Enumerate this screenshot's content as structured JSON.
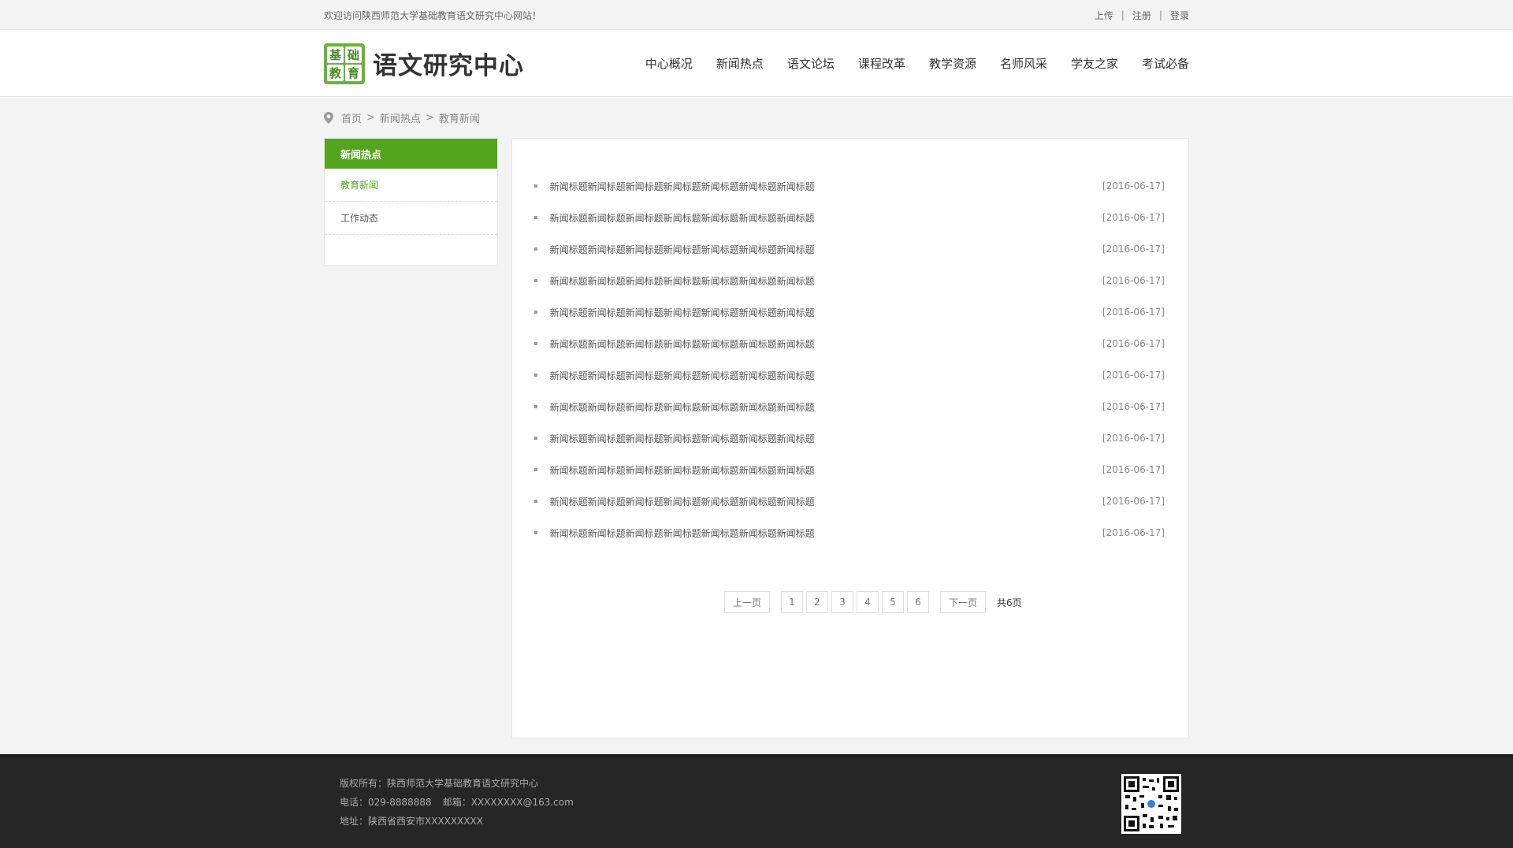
{
  "topbar": {
    "welcome": "欢迎访问陕西师范大学基础教育语文研究中心网站！",
    "links": [
      "上传",
      "注册",
      "登录"
    ]
  },
  "logo": {
    "badge_chars": [
      "基",
      "础",
      "教",
      "育"
    ],
    "title": "语文研究中心"
  },
  "nav": [
    "中心概况",
    "新闻热点",
    "语文论坛",
    "课程改革",
    "教学资源",
    "名师风采",
    "学友之家",
    "考试必备"
  ],
  "breadcrumb": {
    "items": [
      "首页",
      "新闻热点",
      "教育新闻"
    ],
    "separator": ">"
  },
  "sidebar": {
    "title": "新闻热点",
    "items": [
      {
        "label": "教育新闻",
        "active": true
      },
      {
        "label": "工作动态",
        "active": false
      }
    ]
  },
  "news": [
    {
      "title": "新闻标题新闻标题新闻标题新闻标题新闻标题新闻标题新闻标题",
      "date": "[2016-06-17]"
    },
    {
      "title": "新闻标题新闻标题新闻标题新闻标题新闻标题新闻标题新闻标题",
      "date": "[2016-06-17]"
    },
    {
      "title": "新闻标题新闻标题新闻标题新闻标题新闻标题新闻标题新闻标题",
      "date": "[2016-06-17]"
    },
    {
      "title": "新闻标题新闻标题新闻标题新闻标题新闻标题新闻标题新闻标题",
      "date": "[2016-06-17]"
    },
    {
      "title": "新闻标题新闻标题新闻标题新闻标题新闻标题新闻标题新闻标题",
      "date": "[2016-06-17]"
    },
    {
      "title": "新闻标题新闻标题新闻标题新闻标题新闻标题新闻标题新闻标题",
      "date": "[2016-06-17]"
    },
    {
      "title": "新闻标题新闻标题新闻标题新闻标题新闻标题新闻标题新闻标题",
      "date": "[2016-06-17]"
    },
    {
      "title": "新闻标题新闻标题新闻标题新闻标题新闻标题新闻标题新闻标题",
      "date": "[2016-06-17]"
    },
    {
      "title": "新闻标题新闻标题新闻标题新闻标题新闻标题新闻标题新闻标题",
      "date": "[2016-06-17]"
    },
    {
      "title": "新闻标题新闻标题新闻标题新闻标题新闻标题新闻标题新闻标题",
      "date": "[2016-06-17]"
    },
    {
      "title": "新闻标题新闻标题新闻标题新闻标题新闻标题新闻标题新闻标题",
      "date": "[2016-06-17]"
    },
    {
      "title": "新闻标题新闻标题新闻标题新闻标题新闻标题新闻标题新闻标题",
      "date": "[2016-06-17]"
    }
  ],
  "pager": {
    "prev": "上一页",
    "pages": [
      "1",
      "2",
      "3",
      "4",
      "5",
      "6"
    ],
    "next": "下一页",
    "total": "共6页"
  },
  "footer": {
    "copyright": "版权所有：陕西师范大学基础教育语文研究中心",
    "phone": "电话：029-8888888",
    "email": "邮箱：XXXXXXXX@163.com",
    "address": "地址：陕西省西安市XXXXXXXXX"
  },
  "colors": {
    "accent_green": "#54a51e",
    "footer_bg": "#262626"
  },
  "icons": [
    "location-pin-icon",
    "qr-code-icon"
  ]
}
